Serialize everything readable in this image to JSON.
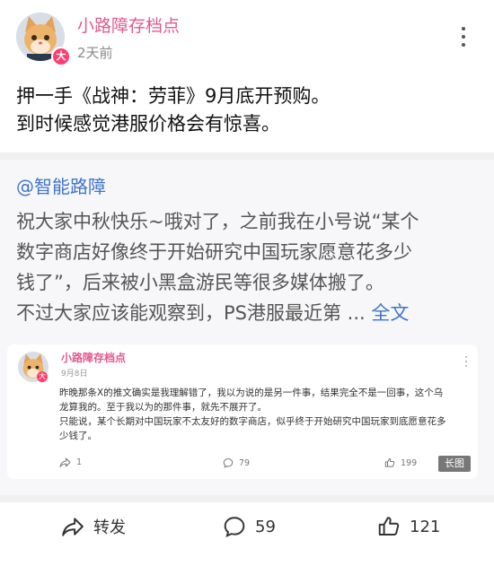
{
  "post": {
    "author": "小路障存档点",
    "badge": "大",
    "time": "2天前",
    "lines": [
      "押一手《战神：劳菲》9月底开预购。",
      "到时候感觉港服价格会有惊喜。"
    ]
  },
  "quote": {
    "mention": "@智能路障",
    "lines": [
      "祝大家中秋快乐~哦对了，之前我在小号说“某个",
      "数字商店好像终于开始研究中国玩家愿意花多少",
      "钱了”，后来被小黑盒游民等很多媒体搬了。",
      "不过大家应该能观察到，PS港服最近第 ..."
    ],
    "fulltext": "全文",
    "inner": {
      "author": "小路障存档点",
      "badge": "大",
      "date": "9月8日",
      "lines": [
        "昨晚那条X的推文确实是我理解错了，我以为说的是另一件事，结果完全不是一回事，这个乌",
        "龙算我的。至于我以为的那件事，就先不展开了。",
        "只能说，某个长期对中国玩家不太友好的数字商店，似乎终于开始研究中国玩家到底愿意花多",
        "少钱了。"
      ],
      "share_count": "1",
      "comment_count": "79",
      "like_count": "199",
      "long_image_label": "长图"
    }
  },
  "actions": {
    "share_label": "转发",
    "comment_count": "59",
    "like_count": "121"
  }
}
